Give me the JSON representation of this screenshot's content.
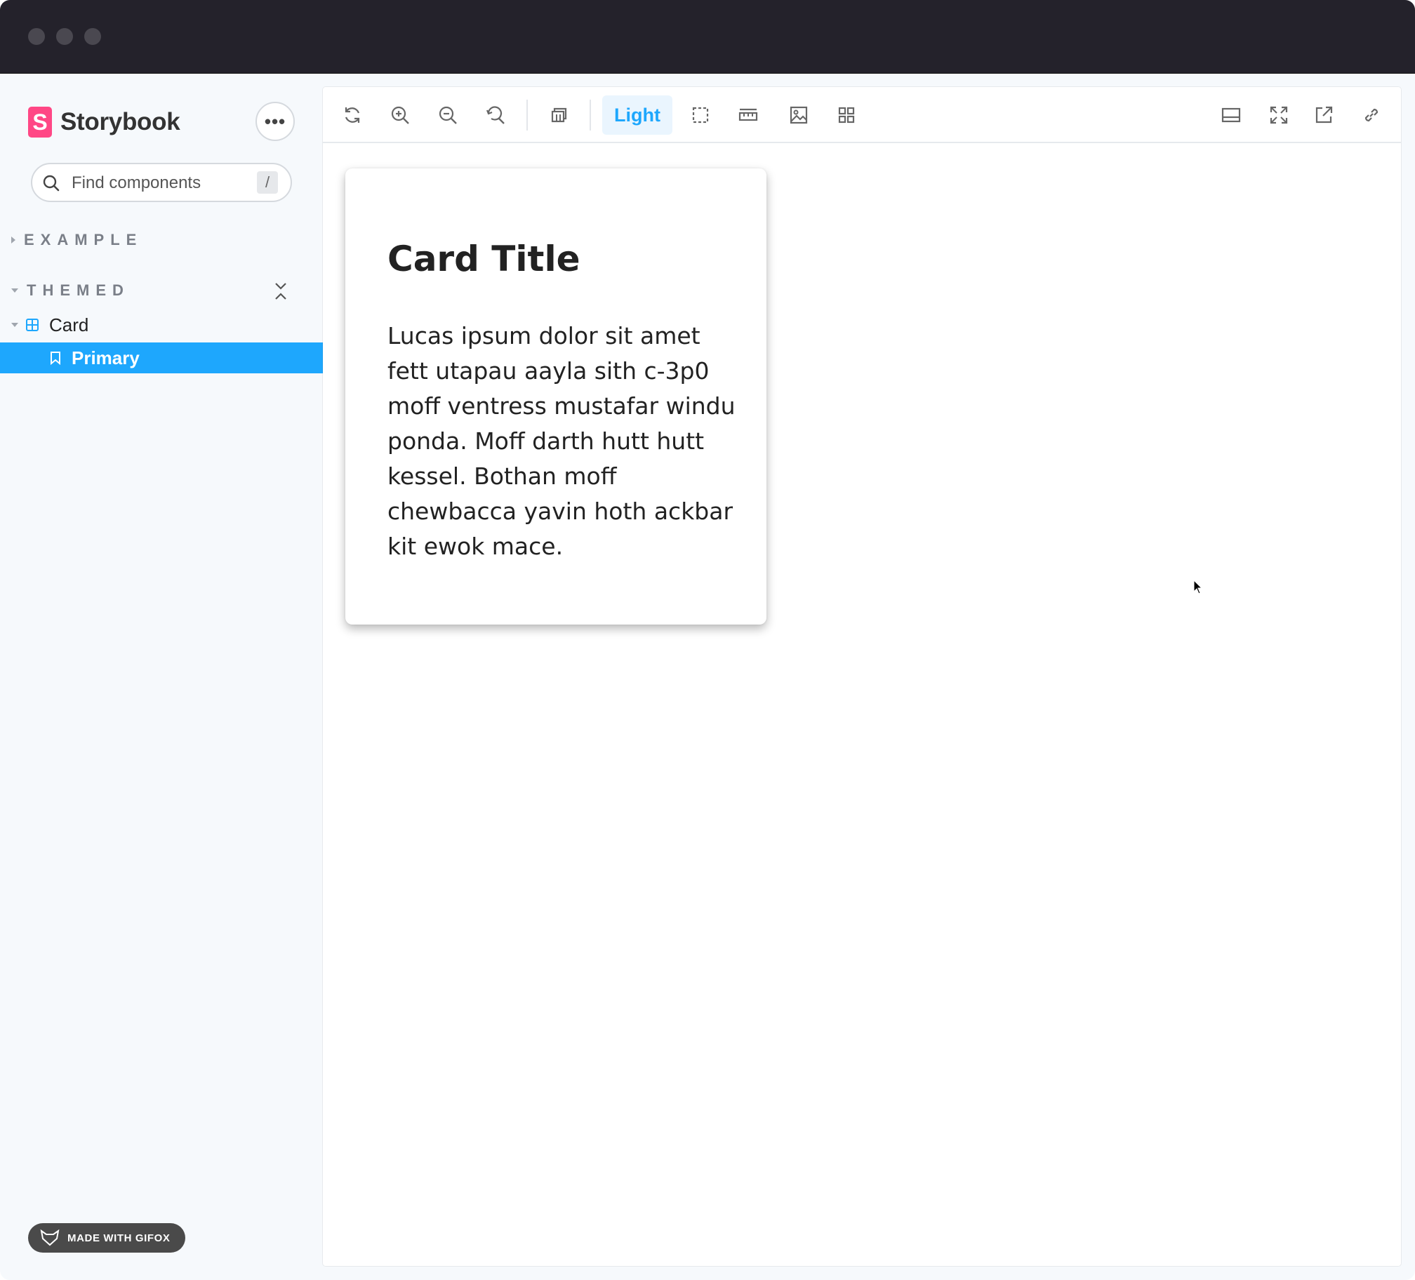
{
  "sidebar": {
    "brand": {
      "logo_letter": "S",
      "name": "Storybook",
      "logo_color": "#ff4785"
    },
    "menu_button_label": "•••",
    "search": {
      "placeholder": "Find components",
      "shortcut": "/"
    },
    "groups": [
      {
        "label": "EXAMPLE",
        "expanded": false
      },
      {
        "label": "THEMED",
        "expanded": true
      }
    ],
    "tree": {
      "component": {
        "label": "Card",
        "icon": "component-icon"
      },
      "story": {
        "label": "Primary",
        "icon": "bookmark-icon",
        "selected": true
      }
    },
    "badge": "MADE WITH GIFOX"
  },
  "toolbar": {
    "left_tools": [
      "reload-icon",
      "zoom-in-icon",
      "zoom-out-icon",
      "zoom-reset-icon",
      "grid-icon"
    ],
    "background_label": "Light",
    "right_tools": [
      "outline-icon",
      "measure-icon",
      "image-icon",
      "viewport-icon"
    ],
    "far_right_tools": [
      "bottom-panel-icon",
      "fullscreen-icon",
      "open-new-tab-icon",
      "link-icon"
    ]
  },
  "card": {
    "title": "Card Title",
    "body": "Lucas ipsum dolor sit amet fett utapau aayla sith c-3p0 moff ventress mustafar windu ponda. Moff darth hutt hutt kessel. Bothan moff chewbacca yavin hoth ackbar kit ewok mace."
  },
  "colors": {
    "accent": "#1ea7fd",
    "titlebar": "#24222b",
    "sidebar_bg": "#f6f9fc"
  }
}
